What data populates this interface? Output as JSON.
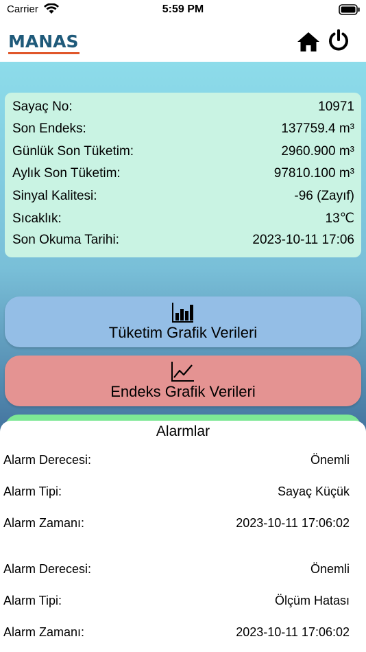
{
  "status_bar": {
    "carrier": "Carrier",
    "time": "5:59 PM"
  },
  "nav": {
    "logo": "MANAS",
    "home_icon": "home-icon",
    "power_icon": "power-icon"
  },
  "meter": {
    "rows": [
      {
        "label": "Sayaç No:",
        "value": "10971"
      },
      {
        "label": "Son Endeks:",
        "value": "137759.4 m³"
      },
      {
        "label": "Günlük Son Tüketim:",
        "value": "2960.900 m³"
      },
      {
        "label": "Aylık Son Tüketim:",
        "value": "97810.100 m³"
      },
      {
        "label": "Sinyal Kalitesi:",
        "value": "-96 (Zayıf)"
      },
      {
        "label": "Sıcaklık:",
        "value": "13℃"
      },
      {
        "label": "Son Okuma Tarihi:",
        "value": "2023-10-11 17:06"
      }
    ]
  },
  "buttons": {
    "consumption": {
      "label": "Tüketim Grafik Verileri",
      "icon": "bar-chart-icon"
    },
    "index": {
      "label": "Endeks Grafik Verileri",
      "icon": "line-chart-icon"
    }
  },
  "alarms": {
    "title": "Alarmlar",
    "items": [
      {
        "severity_label": "Alarm Derecesi:",
        "severity": "Önemli",
        "type_label": "Alarm Tipi:",
        "type": "Sayaç Küçük",
        "time_label": "Alarm Zamanı:",
        "time": "2023-10-11 17:06:02"
      },
      {
        "severity_label": "Alarm Derecesi:",
        "severity": "Önemli",
        "type_label": "Alarm Tipi:",
        "type": "Ölçüm Hatası",
        "time_label": "Alarm Zamanı:",
        "time": "2023-10-11 17:06:02"
      }
    ]
  },
  "colors": {
    "card": "#c9f3e3",
    "consumption_button": "#94bee6",
    "index_button": "#e49392",
    "green_button": "#7de895",
    "logo_blue": "#1f5a7a",
    "logo_orange": "#e0562a"
  }
}
